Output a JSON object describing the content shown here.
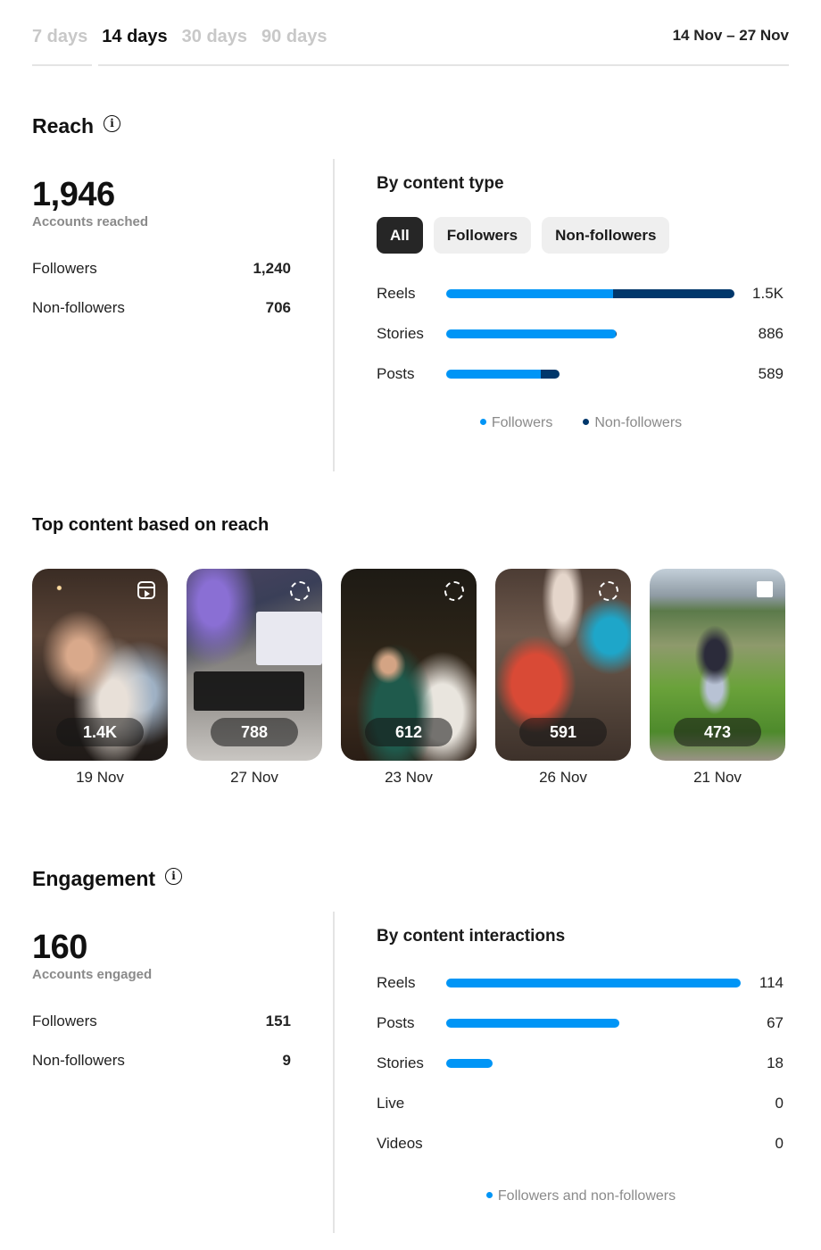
{
  "tabs": [
    {
      "label": "7 days",
      "active": false
    },
    {
      "label": "14 days",
      "active": true
    },
    {
      "label": "30 days",
      "active": false
    },
    {
      "label": "90 days",
      "active": false
    }
  ],
  "date_range": "14 Nov – 27 Nov",
  "reach": {
    "title": "Reach",
    "total": "1,946",
    "total_label": "Accounts reached",
    "rows": [
      {
        "label": "Followers",
        "value": "1,240"
      },
      {
        "label": "Non-followers",
        "value": "706"
      }
    ],
    "by_content_type": {
      "title": "By content type",
      "filters": [
        {
          "label": "All",
          "active": true
        },
        {
          "label": "Followers",
          "active": false
        },
        {
          "label": "Non-followers",
          "active": false
        }
      ],
      "max_value": 1500,
      "bars": [
        {
          "label": "Reels",
          "value_label": "1.5K",
          "total": 1500,
          "followers": 870,
          "non_followers": 630
        },
        {
          "label": "Stories",
          "value_label": "886",
          "total": 886,
          "followers": 884,
          "non_followers": 2
        },
        {
          "label": "Posts",
          "value_label": "589",
          "total": 589,
          "followers": 492,
          "non_followers": 97
        }
      ],
      "legend": [
        {
          "label": "Followers",
          "color": "#0095f6"
        },
        {
          "label": "Non-followers",
          "color": "#00376b"
        }
      ]
    }
  },
  "top_content": {
    "title": "Top content based on reach",
    "items": [
      {
        "count": "1.4K",
        "date": "19 Nov",
        "type_icon": "reel-icon"
      },
      {
        "count": "788",
        "date": "27 Nov",
        "type_icon": "story-ring-icon"
      },
      {
        "count": "612",
        "date": "23 Nov",
        "type_icon": "story-ring-icon"
      },
      {
        "count": "591",
        "date": "26 Nov",
        "type_icon": "story-ring-icon"
      },
      {
        "count": "473",
        "date": "21 Nov",
        "type_icon": "post-square-icon"
      }
    ]
  },
  "engagement": {
    "title": "Engagement",
    "total": "160",
    "total_label": "Accounts engaged",
    "rows": [
      {
        "label": "Followers",
        "value": "151"
      },
      {
        "label": "Non-followers",
        "value": "9"
      }
    ],
    "by_content_interactions": {
      "title": "By content interactions",
      "max_value": 114,
      "bars": [
        {
          "label": "Reels",
          "value_label": "114",
          "total": 114
        },
        {
          "label": "Posts",
          "value_label": "67",
          "total": 67
        },
        {
          "label": "Stories",
          "value_label": "18",
          "total": 18
        },
        {
          "label": "Live",
          "value_label": "0",
          "total": 0
        },
        {
          "label": "Videos",
          "value_label": "0",
          "total": 0
        }
      ],
      "legend": [
        {
          "label": "Followers and non-followers",
          "color": "#0095f6"
        }
      ]
    }
  }
}
